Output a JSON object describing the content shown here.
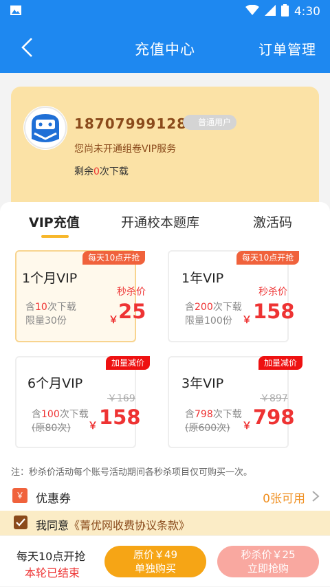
{
  "status_bar": {
    "time": "4:30",
    "icons": [
      "image-icon",
      "wifi-icon",
      "signal-icon",
      "battery-icon"
    ]
  },
  "header": {
    "title": "充值中心",
    "right_action": "订单管理"
  },
  "user": {
    "phone": "18707999128",
    "badge": "普通用户",
    "vip_status": "您尚未开通组卷VIP服务",
    "remain_prefix": "剩余",
    "remain_count": "0",
    "remain_suffix": "次下载"
  },
  "tabs": [
    {
      "label": "VIP充值",
      "active": true
    },
    {
      "label": "开通校本题库",
      "active": false
    },
    {
      "label": "激活码",
      "active": false
    }
  ],
  "plans": [
    {
      "ribbon": "每天10点开抢",
      "title": "1个月VIP",
      "tag": "秒杀价",
      "line1_pre": "含",
      "line1_num": "10",
      "line1_suf": "次下载",
      "line2": "限量30份",
      "price": "25",
      "selected": true
    },
    {
      "ribbon": "每天10点开抢",
      "title": "1年VIP",
      "tag": "秒杀价",
      "line1_pre": "含",
      "line1_num": "200",
      "line1_suf": "次下载",
      "line2": "限量100份",
      "price": "158",
      "selected": false
    },
    {
      "ribbon": "加量减价",
      "title": "6个月VIP",
      "old_price": "￥169",
      "line1_pre": "含",
      "line1_num": "100",
      "line1_suf": "次下载",
      "line2": "(原80次)",
      "price": "158",
      "selected": false
    },
    {
      "ribbon": "加量减价",
      "title": "3年VIP",
      "old_price": "￥897",
      "line1_pre": "含",
      "line1_num": "798",
      "line1_suf": "次下载",
      "line2": "(原600次)",
      "price": "798",
      "selected": false
    }
  ],
  "currency": "￥",
  "note": "注：秒杀价活动每个账号活动期间各秒杀项目仅可购买一次。",
  "coupon": {
    "icon": "￥",
    "label": "优惠券",
    "value": "0张可用"
  },
  "agreement": {
    "prefix": "我同意",
    "link": "《菁优网收费协议条款》"
  },
  "bottom": {
    "line1": "每天10点开抢",
    "line2": "本轮已结束",
    "btn1_line1": "原价￥49",
    "btn1_line2": "单独购买",
    "btn2_line1": "秒杀价￥25",
    "btn2_line2": "立即抢购"
  },
  "colors": {
    "primary": "#1e88f0",
    "accent": "#e33333",
    "gold": "#8a4a1b",
    "orange": "#f6a515"
  }
}
